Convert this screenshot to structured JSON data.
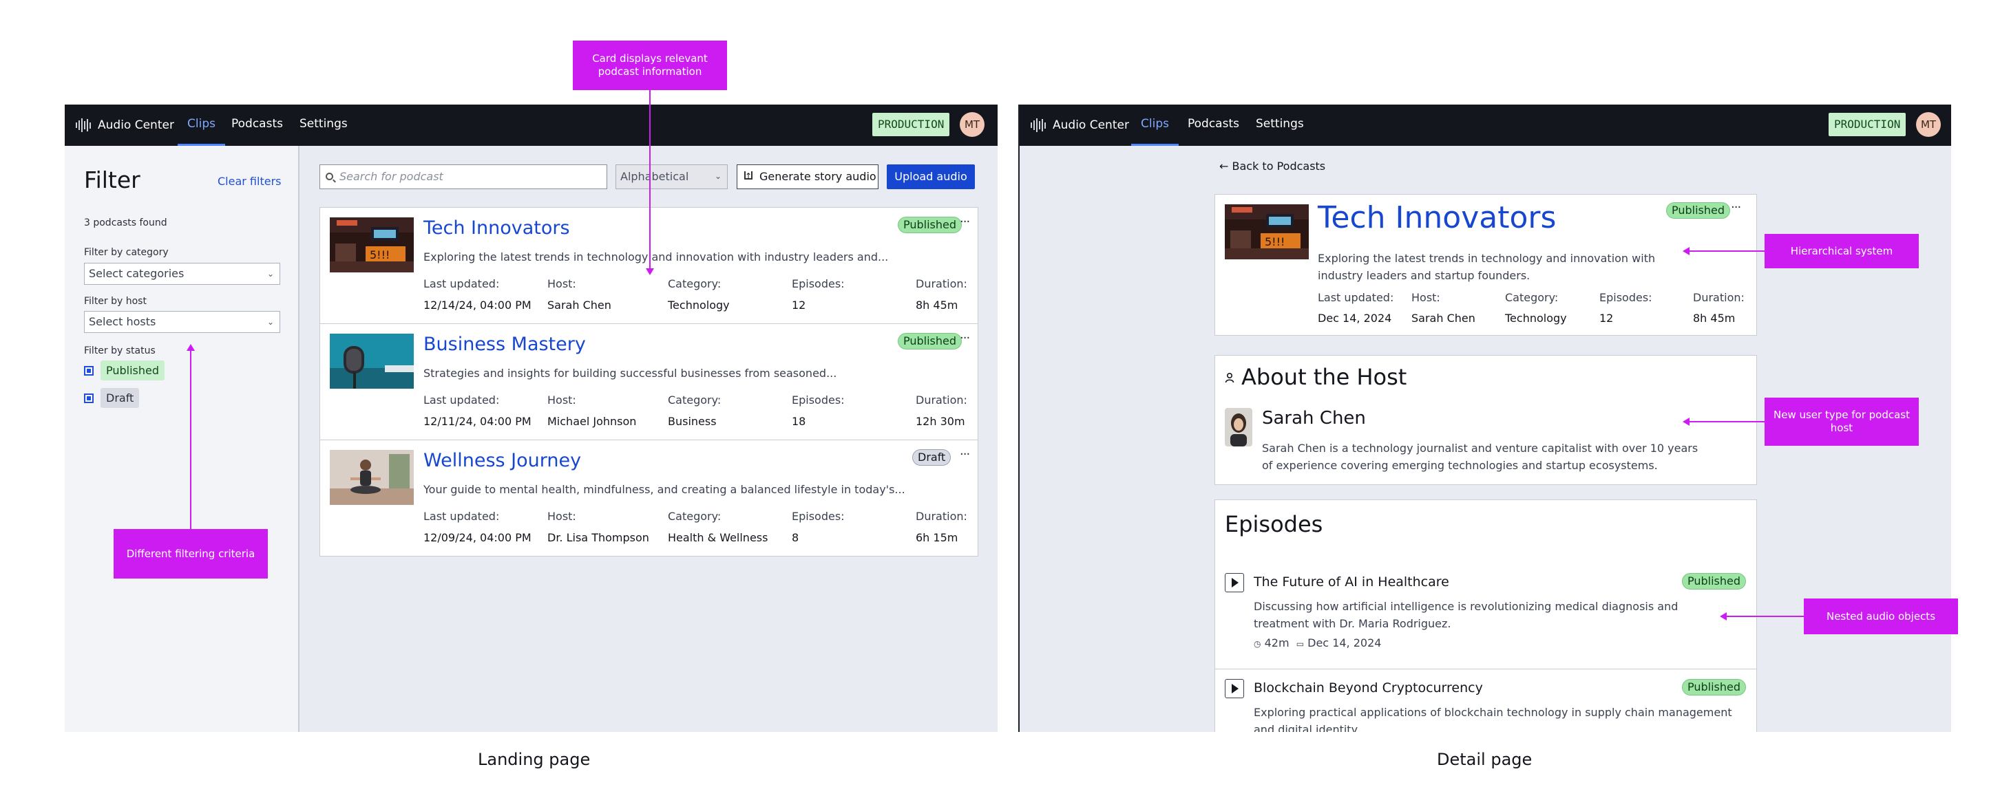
{
  "colors": {
    "nav_bg": "#14161d",
    "accent_blue": "#1747d0",
    "published_green": "#9ee4a4",
    "draft_gray": "#d8dbe4",
    "annotation_magenta": "#cc1cf2",
    "panel_bg": "#e8ebf2"
  },
  "nav": {
    "brand": "Audio Center",
    "brand_icon": "waveform-icon",
    "tabs": [
      "Clips",
      "Podcasts",
      "Settings"
    ],
    "active_tab": "Clips",
    "env_badge": "PRODUCTION",
    "user_initials": "MT"
  },
  "landing": {
    "filter": {
      "title": "Filter",
      "clear_label": "Clear filters",
      "count_text": "3 podcasts found",
      "category_label": "Filter by category",
      "category_placeholder": "Select categories",
      "host_label": "Filter by host",
      "host_placeholder": "Select hosts",
      "status_label": "Filter by status",
      "statuses": [
        "Published",
        "Draft"
      ]
    },
    "toolbar": {
      "search_placeholder": "Search for podcast",
      "sort_value": "Alphabetical",
      "generate_label": "Generate story audio",
      "upload_label": "Upload audio"
    },
    "meta_labels": {
      "updated": "Last updated:",
      "host": "Host:",
      "category": "Category:",
      "episodes": "Episodes:",
      "duration": "Duration:"
    },
    "podcasts": [
      {
        "title": "Tech Innovators",
        "description": "Exploring the latest trends in technology and innovation with industry leaders and...",
        "status": "Published",
        "updated": "12/14/24, 04:00 PM",
        "host": "Sarah Chen",
        "category": "Technology",
        "episodes": "12",
        "duration": "8h 45m"
      },
      {
        "title": "Business Mastery",
        "description": "Strategies and insights for building successful businesses from seasoned...",
        "status": "Published",
        "updated": "12/11/24, 04:00 PM",
        "host": "Michael Johnson",
        "category": "Business",
        "episodes": "18",
        "duration": "12h 30m"
      },
      {
        "title": "Wellness Journey",
        "description": "Your guide to mental health, mindfulness, and creating a balanced lifestyle in today's...",
        "status": "Draft",
        "updated": "12/09/24, 04:00 PM",
        "host": "Dr. Lisa Thompson",
        "category": "Health & Wellness",
        "episodes": "8",
        "duration": "6h 15m"
      }
    ]
  },
  "detail": {
    "back_label": "← Back to Podcasts",
    "podcast": {
      "title": "Tech Innovators",
      "status": "Published",
      "description": "Exploring the latest trends in technology and innovation with industry leaders and startup founders.",
      "updated": "Dec 14, 2024",
      "host": "Sarah Chen",
      "category": "Technology",
      "episodes": "12",
      "duration": "8h 45m"
    },
    "about_host": {
      "heading": "About the Host",
      "name": "Sarah Chen",
      "bio": "Sarah Chen is a technology journalist and venture capitalist with over 10 years of experience covering emerging technologies and startup ecosystems."
    },
    "episodes_heading": "Episodes",
    "episodes": [
      {
        "title": "The Future of AI in Healthcare",
        "status": "Published",
        "description": "Discussing how artificial intelligence is revolutionizing medical diagnosis and treatment with Dr. Maria Rodriguez.",
        "duration": "42m",
        "date": "Dec 14, 2024"
      },
      {
        "title": "Blockchain Beyond Cryptocurrency",
        "status": "Published",
        "description": "Exploring practical applications of blockchain technology in supply chain management and digital identity."
      }
    ]
  },
  "annotations": {
    "card_info": "Card displays relevant podcast information",
    "filtering": "Different filtering criteria",
    "hierarchical": "Hierarchical system",
    "host_type": "New user type for podcast host",
    "nested_audio": "Nested audio objects"
  },
  "captions": {
    "landing": "Landing page",
    "detail": "Detail page"
  }
}
